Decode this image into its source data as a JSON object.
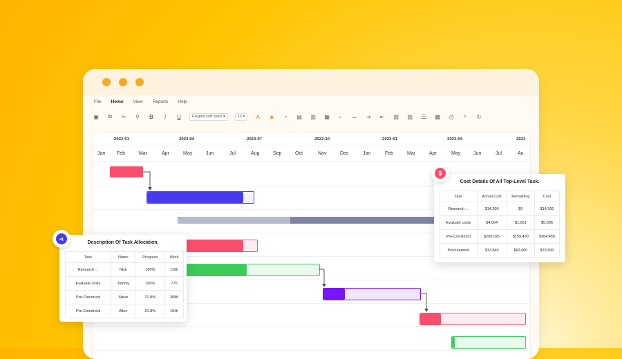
{
  "menu": {
    "items": [
      "File",
      "Home",
      "View",
      "Reports",
      "Help"
    ],
    "active": "Home"
  },
  "toolbar": {
    "font_name": "Elegant soft black",
    "font_size": "12"
  },
  "timeline": {
    "years": [
      "2022-01",
      "2023-04",
      "2023-07",
      "2022-10",
      "2023-01",
      "2023-04",
      "2023"
    ],
    "months": [
      "Jan",
      "Feb",
      "Mar",
      "Apr",
      "May",
      "Jun",
      "Jul",
      "Aug",
      "Sep",
      "Oct",
      "Nov",
      "Dec",
      "Jan",
      "Feb",
      "Mar",
      "Apr",
      "May",
      "Jun",
      "Jul",
      "Au"
    ]
  },
  "colors": {
    "red": "#fa4d6b",
    "blue": "#473bf0",
    "gray": "#7f84a3",
    "green": "#3ccc58",
    "purple": "#7a14ff"
  },
  "allocation": {
    "title": "Description Of Task Allocation.",
    "headers": [
      "Task",
      "Name",
      "Progress",
      "Work"
    ],
    "rows": [
      [
        "Research ...",
        "Nick",
        "100%",
        "110h"
      ],
      [
        "Evaluate costs",
        "Tommy",
        "100%",
        "77h"
      ],
      [
        "Pre-Constructi",
        "Steve",
        "21.8%",
        "308h"
      ],
      [
        "Pre-Constructi",
        "Allen",
        "21.8%",
        "154h"
      ]
    ]
  },
  "cost": {
    "title": "Cost Details Of All Top-Level Task.",
    "headers": [
      "Task",
      "Actual Cost",
      "Remaining",
      "Cost"
    ],
    "rows": [
      [
        "Research ...",
        "$14,300",
        "$0",
        "$14,300"
      ],
      [
        "Evaluate costs",
        "$4,004",
        "$1,001",
        "$5,005"
      ],
      [
        "Pre-Constructi",
        "$205,025",
        "$159,430",
        "$364,455"
      ],
      [
        "Procurement",
        "$13,840",
        "$62,660",
        "$76,500"
      ]
    ]
  }
}
